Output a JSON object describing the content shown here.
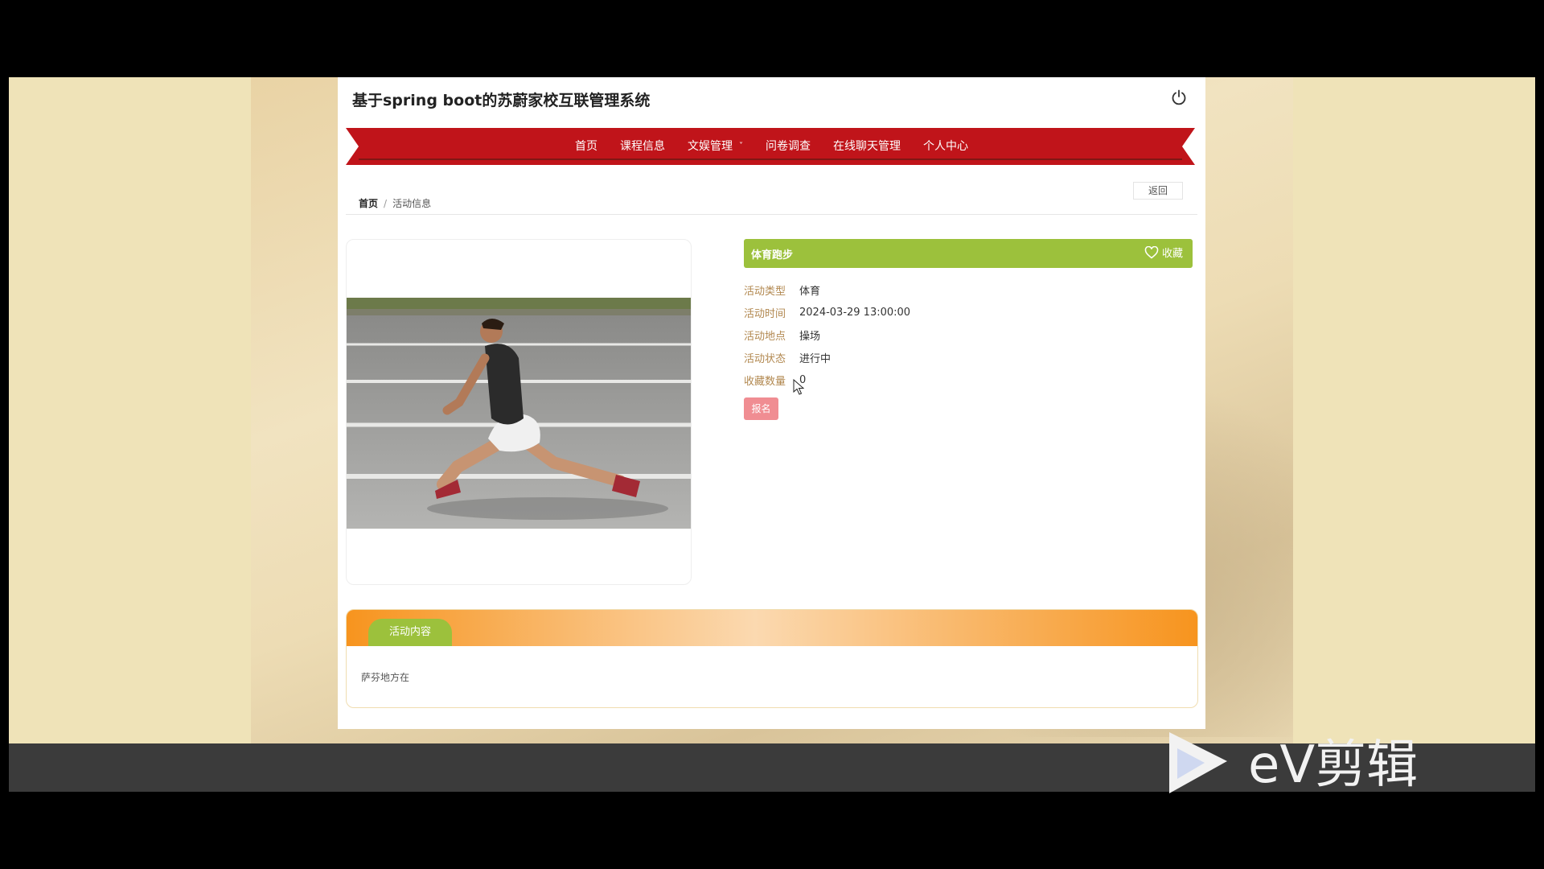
{
  "header": {
    "title": "基于spring boot的苏蔚家校互联管理系统"
  },
  "nav": {
    "items": [
      {
        "label": "首页"
      },
      {
        "label": "课程信息"
      },
      {
        "label": "文娱管理"
      },
      {
        "label": "问卷调查"
      },
      {
        "label": "在线聊天管理"
      },
      {
        "label": "个人中心"
      }
    ],
    "dropdown_chevron": "˅"
  },
  "toolbar": {
    "back_label": "返回"
  },
  "breadcrumb": {
    "home": "首页",
    "separator": "/",
    "current": "活动信息"
  },
  "activity": {
    "title": "体育跑步",
    "favorite_label": "收藏",
    "fields": [
      {
        "label": "活动类型",
        "value": "体育"
      },
      {
        "label": "活动时间",
        "value": "2024-03-29 13:00:00"
      },
      {
        "label": "活动地点",
        "value": "操场"
      },
      {
        "label": "活动状态",
        "value": "进行中"
      },
      {
        "label": "收藏数量",
        "value": "0"
      }
    ],
    "signup_label": "报名"
  },
  "content": {
    "tab_label": "活动内容",
    "text": "萨芬地方在"
  },
  "watermark": {
    "text": "eV剪辑"
  },
  "colors": {
    "nav_red": "#c0141a",
    "accent_green": "#9cc13c",
    "signup_pink": "#f08d92",
    "label_brown": "#b28850",
    "content_orange": "#f7941e"
  },
  "icons": {
    "power": "power-icon",
    "favorite": "heart-outline-icon"
  }
}
